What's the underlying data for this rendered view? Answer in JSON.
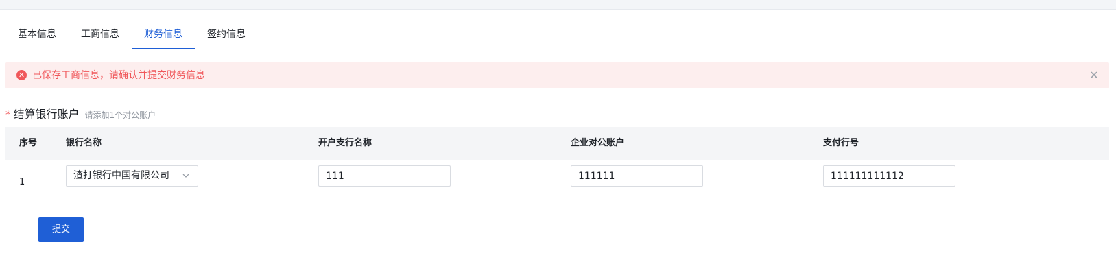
{
  "tabs": [
    {
      "label": "基本信息",
      "active": false
    },
    {
      "label": "工商信息",
      "active": false
    },
    {
      "label": "财务信息",
      "active": true
    },
    {
      "label": "签约信息",
      "active": false
    }
  ],
  "alert": {
    "message": "已保存工商信息，请确认并提交财务信息",
    "icon": "error-circle-icon",
    "close_icon": "close-icon",
    "color": "#f0575a"
  },
  "section": {
    "required_mark": "*",
    "title": "结算银行账户",
    "hint": "请添加1个对公账户"
  },
  "table": {
    "columns": [
      "序号",
      "银行名称",
      "开户支行名称",
      "企业对公账户",
      "支付行号"
    ],
    "rows": [
      {
        "index": "1",
        "bank_name": "渣打银行中国有限公司",
        "branch_name": "111",
        "corporate_account": "111111",
        "payment_bank_code": "111111111112"
      }
    ]
  },
  "actions": {
    "submit_label": "提交"
  },
  "colors": {
    "accent": "#1f5fd6",
    "error": "#f0575a",
    "alert_bg": "#fdeeee"
  }
}
